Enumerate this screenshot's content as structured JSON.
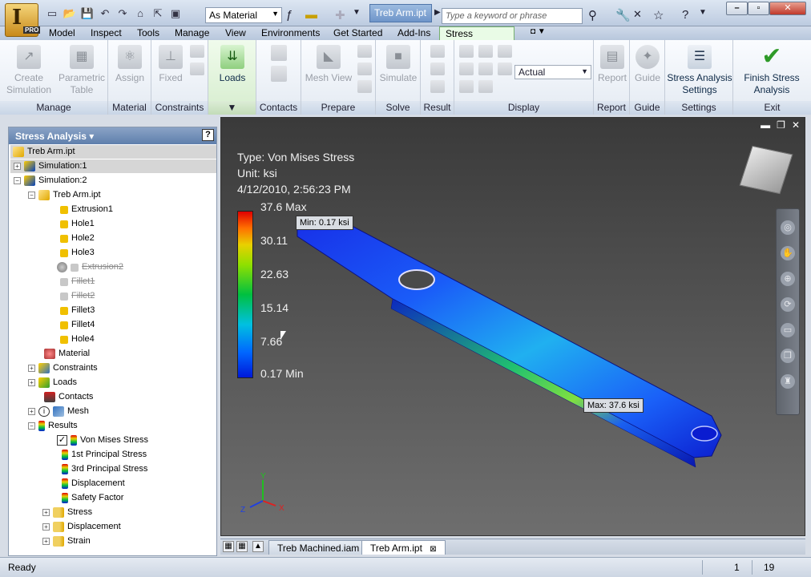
{
  "window": {
    "title_document": "Treb Arm.ipt"
  },
  "quick_access": {
    "material": "As Material"
  },
  "search": {
    "placeholder": "Type a keyword or phrase"
  },
  "menu": {
    "tabs": [
      "Model",
      "Inspect",
      "Tools",
      "Manage",
      "View",
      "Environments",
      "Get Started",
      "Add-Ins"
    ],
    "active_tab": "Stress Analysis"
  },
  "ribbon": {
    "buttons": {
      "create_simulation": "Create Simulation",
      "parametric_table": "Parametric Table",
      "assign": "Assign",
      "fixed": "Fixed",
      "loads": "Loads",
      "mesh_view": "Mesh View",
      "simulate": "Simulate",
      "report": "Report",
      "guide": "Guide",
      "stress_settings": "Stress Analysis Settings",
      "finish": "Finish Stress Analysis"
    },
    "display_value": "Actual",
    "groups": {
      "manage": "Manage",
      "material": "Material",
      "constraints": "Constraints",
      "contacts": "Contacts",
      "prepare": "Prepare",
      "solve": "Solve",
      "result": "Result",
      "display": "Display",
      "report": "Report",
      "guide": "Guide",
      "settings": "Settings",
      "exit": "Exit"
    }
  },
  "browser": {
    "title": "Stress Analysis",
    "help": "?",
    "nodes": {
      "root": "Treb Arm.ipt",
      "sim1": "Simulation:1",
      "sim2": "Simulation:2",
      "part": "Treb Arm.ipt",
      "ext1": "Extrusion1",
      "hole1": "Hole1",
      "hole2": "Hole2",
      "hole3": "Hole3",
      "ext2": "Extrusion2",
      "fillet1": "Fillet1",
      "fillet2": "Fillet2",
      "fillet3": "Fillet3",
      "fillet4": "Fillet4",
      "hole4": "Hole4",
      "material": "Material",
      "constraints": "Constraints",
      "loads": "Loads",
      "contacts": "Contacts",
      "mesh": "Mesh",
      "results": "Results",
      "vonmises": "Von Mises Stress",
      "p1": "1st Principal Stress",
      "p3": "3rd Principal Stress",
      "displacement": "Displacement",
      "safety": "Safety Factor",
      "stress": "Stress",
      "displacement2": "Displacement",
      "strain": "Strain"
    }
  },
  "viewport": {
    "type_line": "Type: Von Mises Stress",
    "unit_line": "Unit: ksi",
    "date_line": "4/12/2010, 2:56:23 PM",
    "legend": {
      "max": "37.6 Max",
      "v1": "30.11",
      "v2": "22.63",
      "v3": "15.14",
      "v4": "7.66",
      "min": "0.17 Min"
    },
    "min_callout": "Min: 0.17 ksi",
    "max_callout": "Max: 37.6 ksi",
    "axis": {
      "x": "X",
      "y": "Y",
      "z": "Z"
    }
  },
  "doc_tabs": [
    "Treb Machined.iam",
    "Treb Arm.ipt"
  ],
  "status": {
    "text": "Ready",
    "n1": "1",
    "n2": "19"
  },
  "colors": {
    "stress_low": "#0018d8",
    "stress_high": "#e00000",
    "active_tab": "#e9fbe6"
  }
}
